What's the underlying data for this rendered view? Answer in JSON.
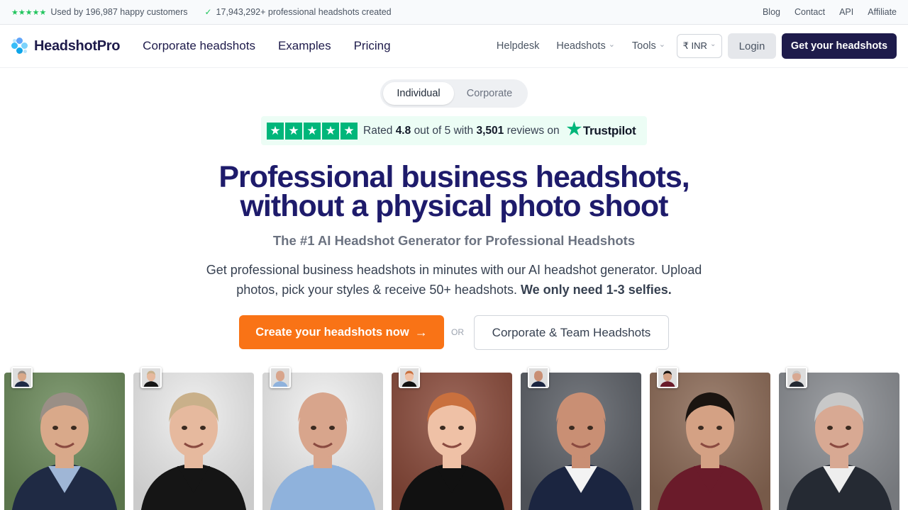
{
  "topbar": {
    "customers_text": "Used by 196,987 happy customers",
    "headshots_text": "17,943,292+ professional headshots created",
    "links": [
      "Blog",
      "Contact",
      "API",
      "Affiliate"
    ]
  },
  "header": {
    "logo": "HeadshotPro",
    "nav": [
      "Corporate headshots",
      "Examples",
      "Pricing"
    ],
    "helpdesk": "Helpdesk",
    "headshots": "Headshots",
    "tools": "Tools",
    "currency": "₹ INR",
    "login": "Login",
    "cta": "Get your headshots"
  },
  "toggle": {
    "options": [
      "Individual",
      "Corporate"
    ],
    "selected": "Individual"
  },
  "trustpilot": {
    "prefix": "Rated",
    "rating": "4.8",
    "middle": "out of 5 with",
    "reviews": "3,501",
    "suffix": "reviews on",
    "brand": "Trustpilot"
  },
  "hero": {
    "title_line1": "Professional business headshots,",
    "title_line2": "without a physical photo shoot",
    "subtitle": "The #1 AI Headshot Generator for Professional Headshots",
    "description": "Get professional business headshots in minutes with our AI headshot generator. Upload photos, pick your styles & receive 50+ headshots.",
    "description_bold": "We only need 1-3 selfies.",
    "cta_primary": "Create your headshots now",
    "or": "OR",
    "cta_secondary": "Corporate & Team Headshots"
  },
  "colors": {
    "brand_navy": "#1e1b4b",
    "cta_orange": "#f97316",
    "trustpilot_green": "#00b67a",
    "star_green": "#22c55e"
  },
  "photos": [
    {
      "name": "man-gray-hair-park",
      "bg": "#6b8a5a",
      "skin": "#d9a98a",
      "hair": "#9a8f86",
      "suit": "#1f2a44",
      "shirt": "#9fb6d6"
    },
    {
      "name": "woman-blonde-white",
      "bg": "#efefef",
      "skin": "#e6b99e",
      "hair": "#c9b08a",
      "suit": "#151515",
      "shirt": "#151515"
    },
    {
      "name": "man-bald-blue-shirt",
      "bg": "#f2f2f2",
      "skin": "#d8a58c",
      "hair": "#d8a58c",
      "suit": "#8fb2dc",
      "shirt": "#8fb2dc"
    },
    {
      "name": "woman-redhead-brick",
      "bg": "#8a4a3a",
      "skin": "#efc1a6",
      "hair": "#c9703e",
      "suit": "#111111",
      "shirt": "#111111"
    },
    {
      "name": "man-bald-beard-gray",
      "bg": "#5b5f66",
      "skin": "#c98f74",
      "hair": "#c98f74",
      "suit": "#1b2540",
      "shirt": "#f3f3f3"
    },
    {
      "name": "woman-dark-hair-burgundy",
      "bg": "#8c6a56",
      "skin": "#d4a184",
      "hair": "#1a1410",
      "suit": "#6a1b2a",
      "shirt": "#6a1b2a"
    },
    {
      "name": "man-glasses-gray",
      "bg": "#8a8d92",
      "skin": "#d8a993",
      "hair": "#c8c8c8",
      "suit": "#252a33",
      "shirt": "#eeeeee"
    }
  ]
}
